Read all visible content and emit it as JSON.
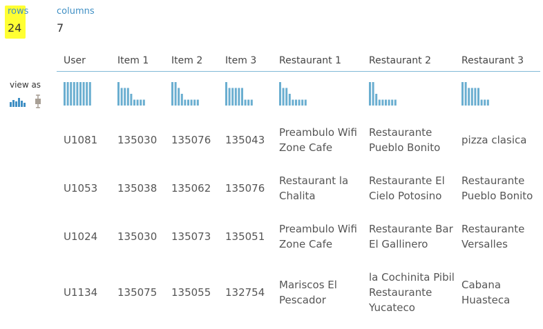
{
  "stats": {
    "rows_label": "rows",
    "rows_value": "24",
    "columns_label": "columns",
    "columns_value": "7"
  },
  "view_as": {
    "label": "view as",
    "icons": [
      "histogram-view-icon",
      "boxplot-view-icon"
    ]
  },
  "colors": {
    "accent": "#3f8fc4",
    "histogram_bar": "#6aaed0",
    "highlight": "#ffff33"
  },
  "table": {
    "columns": [
      "User",
      "Item 1",
      "Item 2",
      "Item 3",
      "Restaurant 1",
      "Restaurant 2",
      "Restaurant 3"
    ],
    "histograms": [
      [
        1.0,
        1.0,
        1.0,
        1.0,
        1.0,
        1.0,
        1.0,
        1.0,
        1.0
      ],
      [
        1.0,
        0.75,
        0.75,
        0.75,
        0.5,
        0.25,
        0.25,
        0.25,
        0.25
      ],
      [
        1.0,
        1.0,
        0.75,
        0.5,
        0.25,
        0.25,
        0.25,
        0.25,
        0.25
      ],
      [
        1.0,
        0.75,
        0.75,
        0.75,
        0.75,
        0.75,
        0.25,
        0.25,
        0.25
      ],
      [
        1.0,
        0.75,
        0.75,
        0.5,
        0.25,
        0.25,
        0.25,
        0.25,
        0.25
      ],
      [
        1.0,
        1.0,
        0.5,
        0.25,
        0.25,
        0.25,
        0.25,
        0.25,
        0.25
      ],
      [
        1.0,
        1.0,
        0.75,
        0.75,
        0.75,
        0.75,
        0.25,
        0.25,
        0.25
      ]
    ],
    "rows": [
      [
        "U1081",
        "135030",
        "135076",
        "135043",
        "Preambulo Wifi Zone Cafe",
        "Restaurante Pueblo Bonito",
        "pizza clasica"
      ],
      [
        "U1053",
        "135038",
        "135062",
        "135076",
        "Restaurant la Chalita",
        "Restaurante El Cielo Potosino",
        "Restaurante Pueblo Bonito"
      ],
      [
        "U1024",
        "135030",
        "135073",
        "135051",
        "Preambulo Wifi Zone Cafe",
        "Restaurante Bar El Gallinero",
        "Restaurante Versalles"
      ],
      [
        "U1134",
        "135075",
        "135055",
        "132754",
        "Mariscos El Pescador",
        "la Cochinita Pibil Restaurante Yucateco",
        "Cabana Huasteca"
      ]
    ]
  }
}
